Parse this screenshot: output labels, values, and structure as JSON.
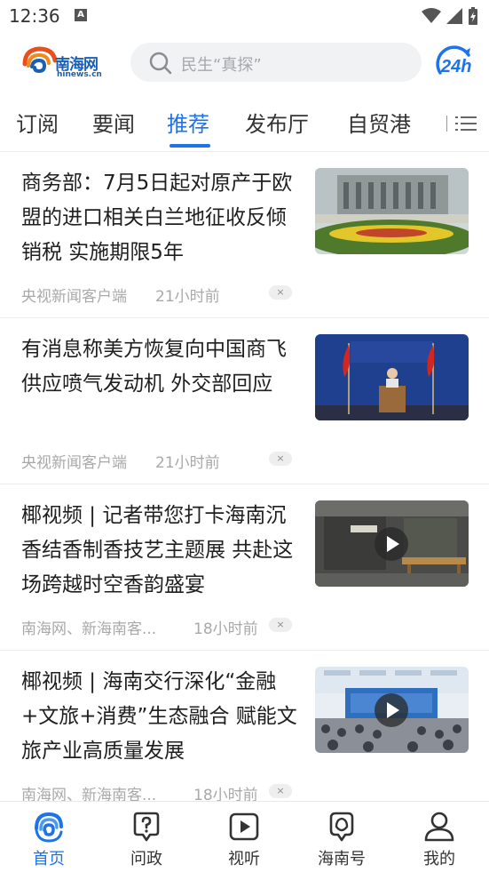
{
  "status": {
    "time": "12:36",
    "a_badge": "A"
  },
  "header": {
    "logo_text": "南海网",
    "logo_sub": "hinews.cn",
    "search_placeholder": "民生“真探”",
    "badge_label": "24h"
  },
  "tabs": [
    {
      "label": "订阅"
    },
    {
      "label": "要闻"
    },
    {
      "label": "推荐"
    },
    {
      "label": "发布厅"
    },
    {
      "label": "自贸港"
    }
  ],
  "news": [
    {
      "title": "商务部：7月5日起对原产于欧盟的进口相关白兰地征收反倾销税 实施期限5年",
      "source": "央视新闻客户端",
      "time": "21小时前",
      "close": "×",
      "thumb": "building-photo",
      "video": false
    },
    {
      "title": "有消息称美方恢复向中国商飞供应喷气发动机 外交部回应",
      "source": "央视新闻客户端",
      "time": "21小时前",
      "close": "×",
      "thumb": "press-conference-photo",
      "video": false
    },
    {
      "title": "椰视频 | 记者带您打卡海南沉香结香制香技艺主题展 共赴这场跨越时空香韵盛宴",
      "source": "南海网、新海南客...",
      "time": "18小时前",
      "close": "×",
      "thumb": "exhibition-photo",
      "video": true
    },
    {
      "title": "椰视频 | 海南交行深化“金融+文旅+消费”生态融合 赋能文旅产业高质量发展",
      "source": "南海网、新海南客...",
      "time": "18小时前",
      "close": "×",
      "thumb": "conference-photo",
      "video": true
    }
  ],
  "bottom_nav": [
    {
      "label": "首页",
      "icon": "home-swirl-icon",
      "active": true
    },
    {
      "label": "问政",
      "icon": "question-bubble-icon",
      "active": false
    },
    {
      "label": "视听",
      "icon": "play-box-icon",
      "active": false
    },
    {
      "label": "海南号",
      "icon": "leaf-pin-icon",
      "active": false
    },
    {
      "label": "我的",
      "icon": "user-icon",
      "active": false
    }
  ],
  "colors": {
    "accent": "#1e73e8",
    "brand": "#1a5fb4",
    "muted": "#a9a9a9"
  }
}
